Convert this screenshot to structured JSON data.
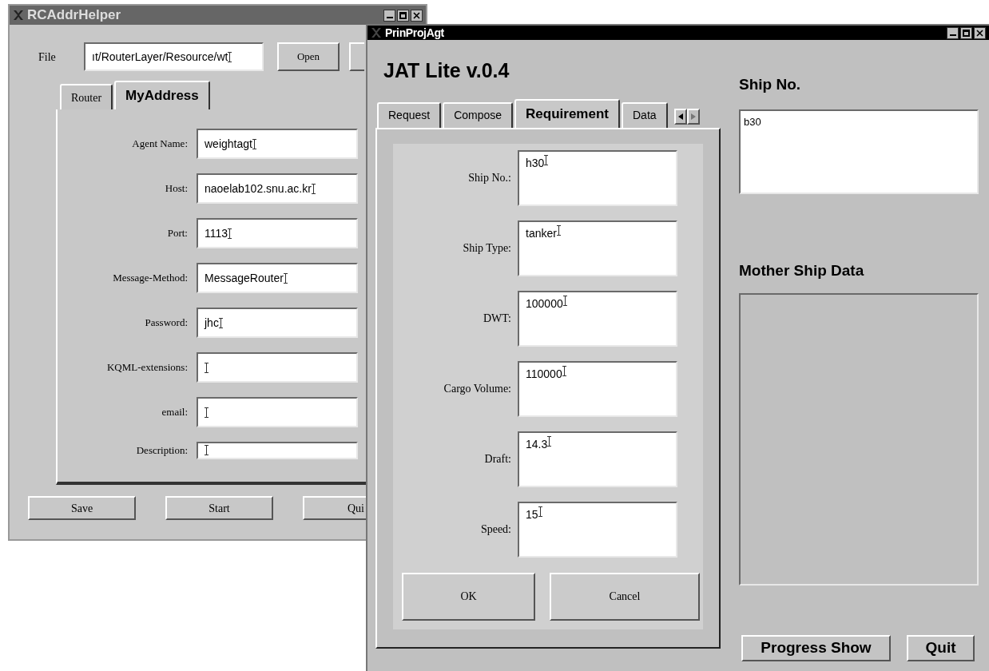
{
  "address_window": {
    "title": "RCAddrHelper",
    "active": false,
    "file": {
      "label": "File",
      "value": "ıt/RouterLayer/Resource/wt"
    },
    "file_buttons": [
      "Open"
    ],
    "tabs": [
      {
        "label": "Router",
        "selected": false
      },
      {
        "label": "MyAddress",
        "selected": true
      }
    ],
    "fields": [
      {
        "label": "Agent Name:",
        "value": "weightagt",
        "short": false
      },
      {
        "label": "Host:",
        "value": "naoelab102.snu.ac.kr",
        "short": false
      },
      {
        "label": "Port:",
        "value": "1113",
        "short": false
      },
      {
        "label": "Message-Method:",
        "value": "MessageRouter",
        "short": false
      },
      {
        "label": "Password:",
        "value": "jhc",
        "short": false
      },
      {
        "label": "KQML-extensions:",
        "short": false
      },
      {
        "label": "email:",
        "short": false
      },
      {
        "label": "Description:",
        "short": true
      }
    ],
    "buttons": [
      "Save",
      "Start",
      "Qui"
    ]
  },
  "project_window": {
    "title": "PrinProjAgt",
    "active": true,
    "heading": "JAT Lite v.0.4",
    "tabs": [
      {
        "label": "Request",
        "selected": false
      },
      {
        "label": "Compose",
        "selected": false
      },
      {
        "label": "Requirement",
        "selected": true
      },
      {
        "label": "Data",
        "selected": false
      }
    ],
    "fields": [
      {
        "label": "Ship No.:",
        "value": "h30"
      },
      {
        "label": "Ship Type:",
        "value": "tanker"
      },
      {
        "label": "DWT:",
        "value": "100000"
      },
      {
        "label": "Cargo Volume:",
        "value": "110000"
      },
      {
        "label": "Draft:",
        "value": "14.3"
      },
      {
        "label": "Speed:",
        "value": "15"
      }
    ],
    "form_buttons": [
      "OK",
      "Cancel"
    ],
    "ship_no": {
      "label": "Ship No.",
      "value": "b30"
    },
    "mother_ship": {
      "label": "Mother Ship Data"
    },
    "buttons": [
      "Progress Show",
      "Quit"
    ]
  }
}
